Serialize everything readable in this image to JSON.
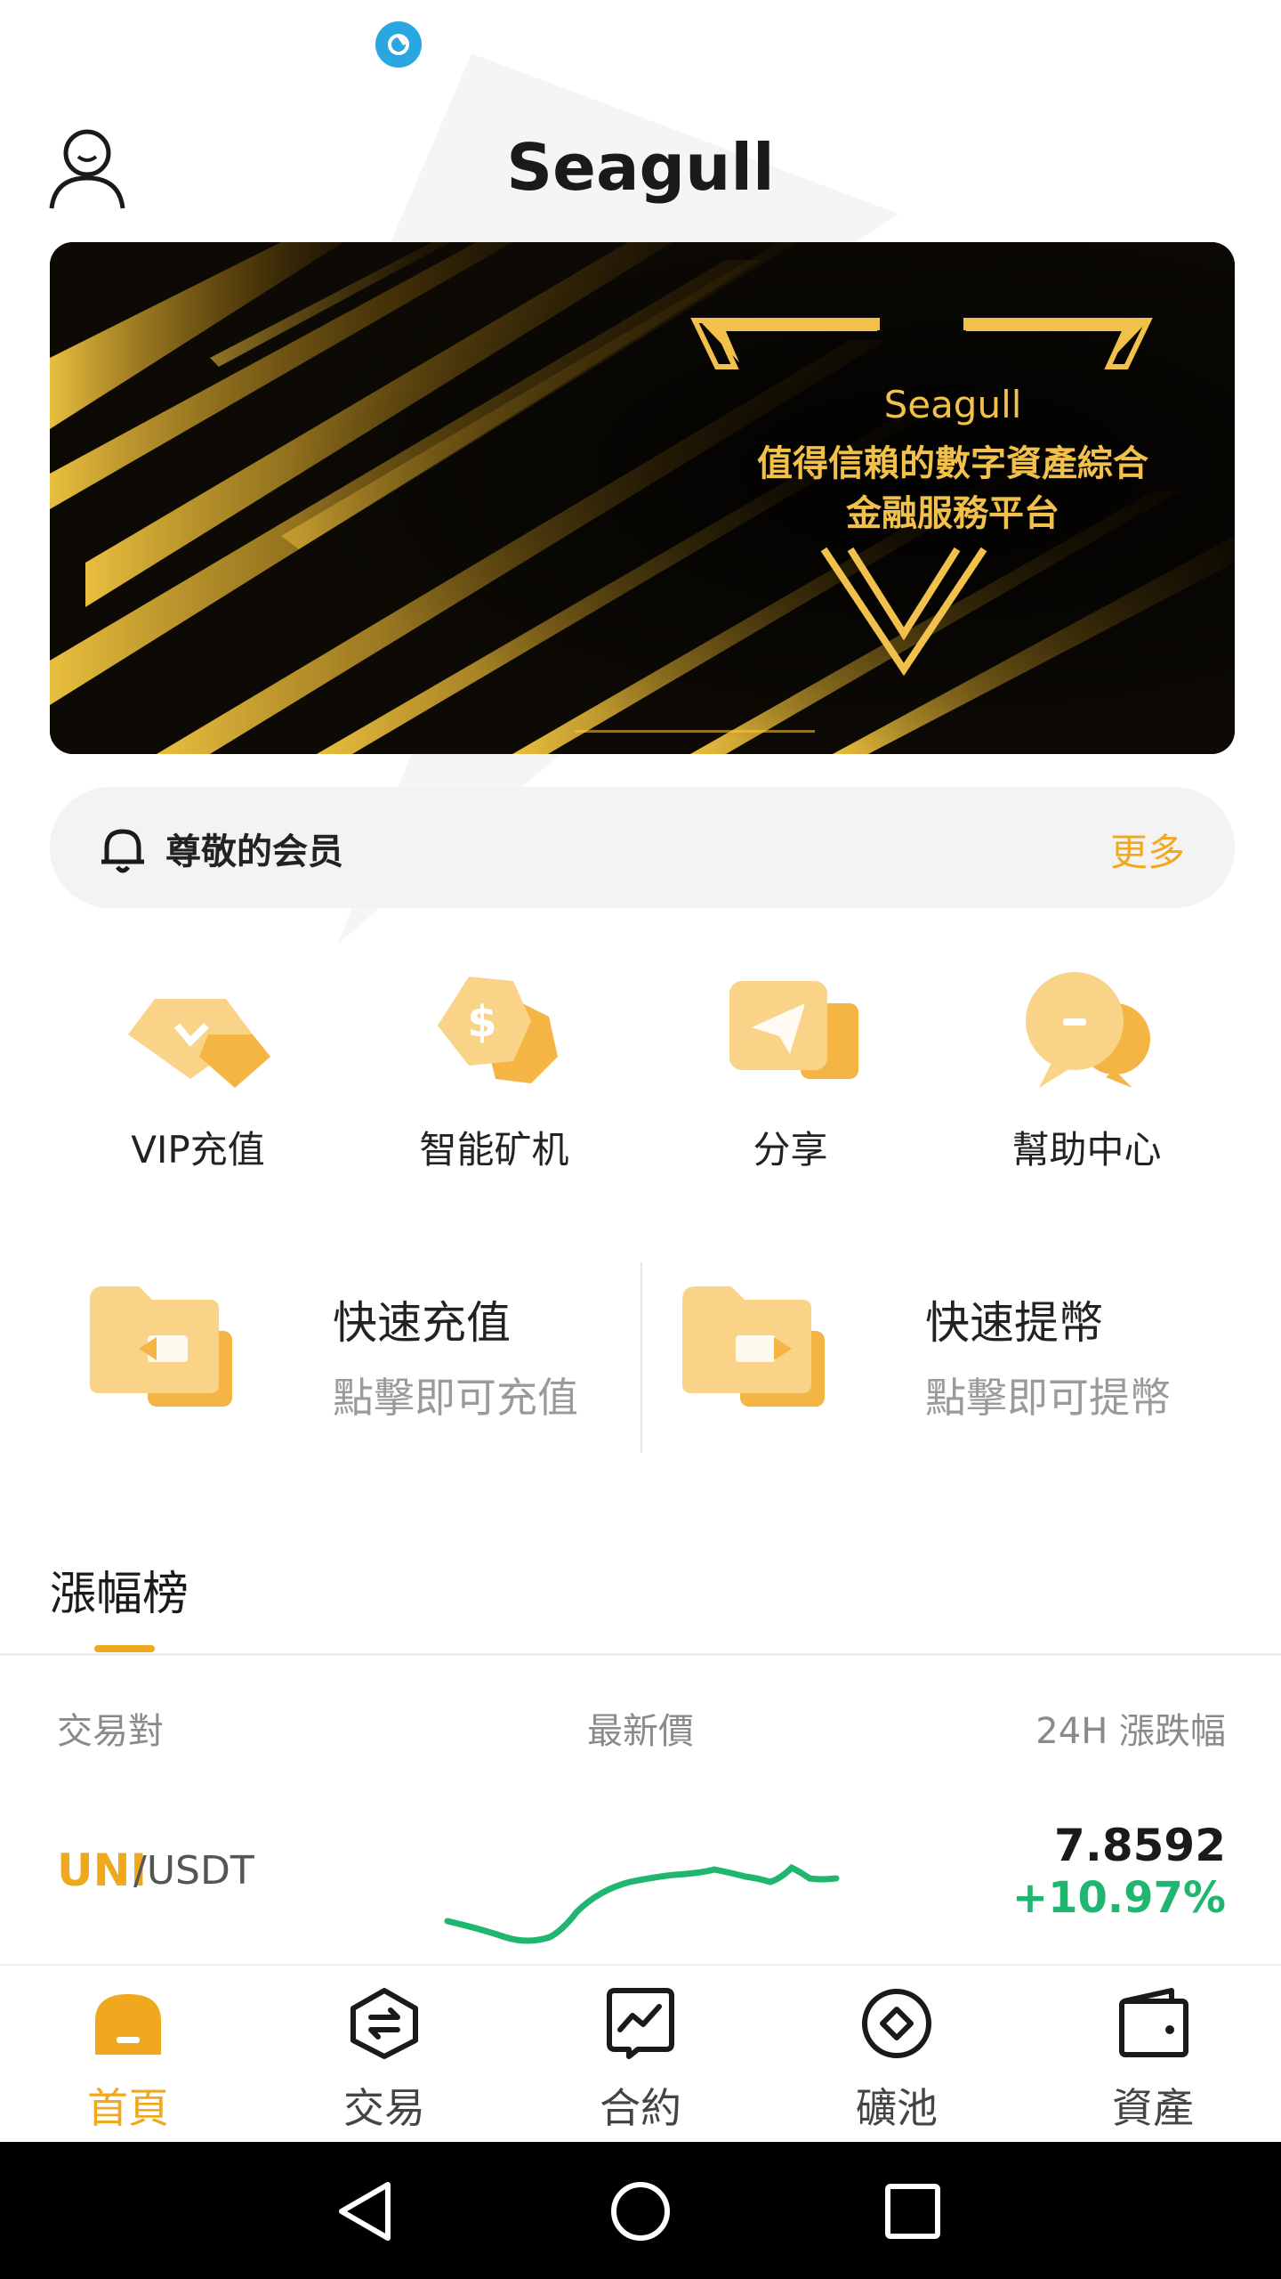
{
  "status": {
    "icon": "app-notification-icon"
  },
  "header": {
    "title": "Seagull",
    "avatar_icon": "user-icon"
  },
  "banner": {
    "brand": "Seagull",
    "line1": "值得信賴的數字資產綜合",
    "line2": "金融服務平台"
  },
  "notice": {
    "icon": "bell-icon",
    "text": "尊敬的会员",
    "more_label": "更多"
  },
  "quick_actions": [
    {
      "label": "VIP充值",
      "icon": "diamond-icon"
    },
    {
      "label": "智能矿机",
      "icon": "coin-icon"
    },
    {
      "label": "分享",
      "icon": "paper-plane-icon"
    },
    {
      "label": "幫助中心",
      "icon": "chat-bubble-icon"
    }
  ],
  "fast": {
    "deposit": {
      "title": "快速充值",
      "subtitle": "點擊即可充值",
      "icon": "folder-deposit-icon"
    },
    "withdraw": {
      "title": "快速提幣",
      "subtitle": "點擊即可提幣",
      "icon": "folder-withdraw-icon"
    }
  },
  "ranking": {
    "tab_label": "漲幅榜",
    "columns": {
      "pair": "交易對",
      "price": "最新價",
      "change": "24H 漲跌幅"
    },
    "rows": [
      {
        "base": "UNI",
        "quote": "/USDT",
        "price": "7.8592",
        "change": "+10.97%"
      }
    ]
  },
  "bottom_nav": [
    {
      "label": "首頁",
      "icon": "home-icon",
      "active": true
    },
    {
      "label": "交易",
      "icon": "exchange-icon",
      "active": false
    },
    {
      "label": "合約",
      "icon": "contract-chart-icon",
      "active": false
    },
    {
      "label": "礦池",
      "icon": "mining-pool-icon",
      "active": false
    },
    {
      "label": "資產",
      "icon": "wallet-icon",
      "active": false
    }
  ],
  "colors": {
    "accent": "#f0a91e",
    "positive": "#1fb76f",
    "text": "#1a1a1a",
    "muted": "#9a9a9a"
  }
}
